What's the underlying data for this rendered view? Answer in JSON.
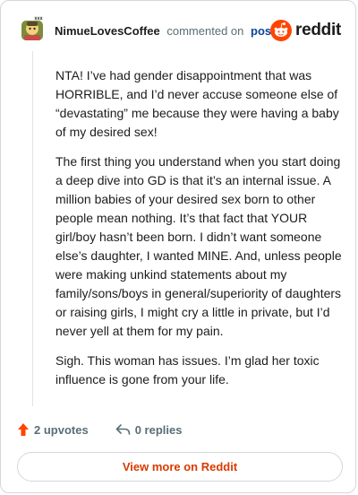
{
  "header": {
    "author": "NimueLovesCoffee",
    "action": "commented on",
    "post_link": "post",
    "logo_text": "reddit"
  },
  "comment": {
    "paragraphs": [
      "NTA! I’ve had gender disappointment that was HORRIBLE, and I’d never accuse someone else of “devastating” me because they were having a baby of my desired sex!",
      "The first thing you understand when you start doing a deep dive into GD is that it’s an internal issue. A million babies of your desired sex born to other people mean nothing. It’s that fact that YOUR girl/boy hasn’t been born. I didn’t want someone else’s daughter, I wanted MINE. And, unless people were making unkind statements about my family/sons/boys in general/superiority of daughters or raising girls, I might cry a little in private, but I’d never yell at them for my pain.",
      "Sigh. This woman has issues. I’m glad her toxic influence is gone from your life."
    ]
  },
  "actions": {
    "upvotes": "2 upvotes",
    "replies": "0 replies"
  },
  "footer": {
    "view_more": "View more on Reddit"
  },
  "icons": {
    "upvote": "upvote-arrow-icon",
    "reply": "reply-arrow-icon",
    "logo": "reddit-snoo-icon",
    "avatar": "user-avatar"
  },
  "colors": {
    "accent": "#ff4500",
    "view_more_text": "#d93a00",
    "link": "#0a449b",
    "muted": "#576f76",
    "border": "#d4d7d9"
  }
}
